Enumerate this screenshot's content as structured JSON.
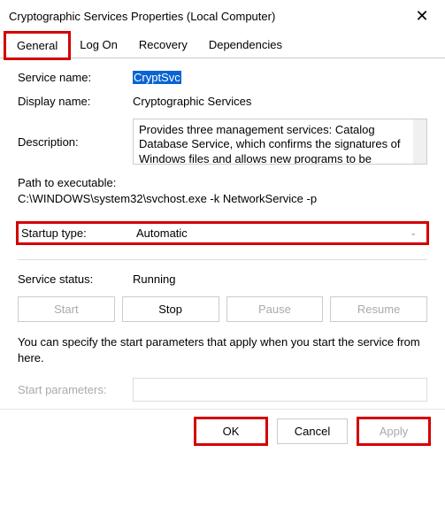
{
  "window": {
    "title": "Cryptographic Services Properties (Local Computer)"
  },
  "tabs": {
    "general": "General",
    "logon": "Log On",
    "recovery": "Recovery",
    "dependencies": "Dependencies"
  },
  "fields": {
    "service_name_label": "Service name:",
    "service_name_value": "CryptSvc",
    "display_name_label": "Display name:",
    "display_name_value": "Cryptographic Services",
    "description_label": "Description:",
    "description_value": "Provides three management services: Catalog Database Service, which confirms the signatures of Windows files and allows new programs to be",
    "path_label": "Path to executable:",
    "path_value": "C:\\WINDOWS\\system32\\svchost.exe -k NetworkService -p",
    "startup_label": "Startup type:",
    "startup_value": "Automatic",
    "status_label": "Service status:",
    "status_value": "Running",
    "hint": "You can specify the start parameters that apply when you start the service from here.",
    "start_params_label": "Start parameters:",
    "start_params_value": ""
  },
  "buttons": {
    "start": "Start",
    "stop": "Stop",
    "pause": "Pause",
    "resume": "Resume",
    "ok": "OK",
    "cancel": "Cancel",
    "apply": "Apply"
  }
}
